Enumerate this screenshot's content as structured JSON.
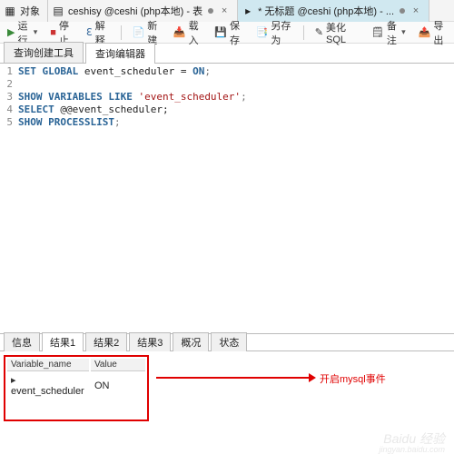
{
  "topTabs": {
    "objects": "对象",
    "tab1": "ceshisy @ceshi (php本地) - 表",
    "tab2": "* 无标题 @ceshi (php本地) - ..."
  },
  "toolbar": {
    "run": "运行",
    "stop": "停止",
    "explain": "解释",
    "new": "新建",
    "load": "载入",
    "save": "保存",
    "saveAs": "另存为",
    "beautify": "美化 SQL",
    "notes": "备注",
    "export": "导出"
  },
  "subTabs": {
    "builder": "查询创建工具",
    "editor": "查询编辑器"
  },
  "sql": {
    "l1a": "SET GLOBAL",
    "l1b": " event_scheduler = ",
    "l1c": "ON",
    "l1d": ";",
    "l3a": "SHOW VARIABLES LIKE",
    "l3b": " 'event_scheduler'",
    "l3c": ";",
    "l4a": "SELECT",
    "l4b": " @@event_scheduler;",
    "l5a": "SHOW PROCESSLIST",
    "l5b": ";"
  },
  "bottomTabs": {
    "info": "信息",
    "r1": "结果1",
    "r2": "结果2",
    "r3": "结果3",
    "profile": "概况",
    "status": "状态"
  },
  "result": {
    "colVar": "Variable_name",
    "colVal": "Value",
    "rowVar": "event_scheduler",
    "rowVal": "ON"
  },
  "annotation": "开启mysql事件",
  "watermark": {
    "main": "Baidu 经验",
    "sub": "jingyan.baidu.com"
  }
}
